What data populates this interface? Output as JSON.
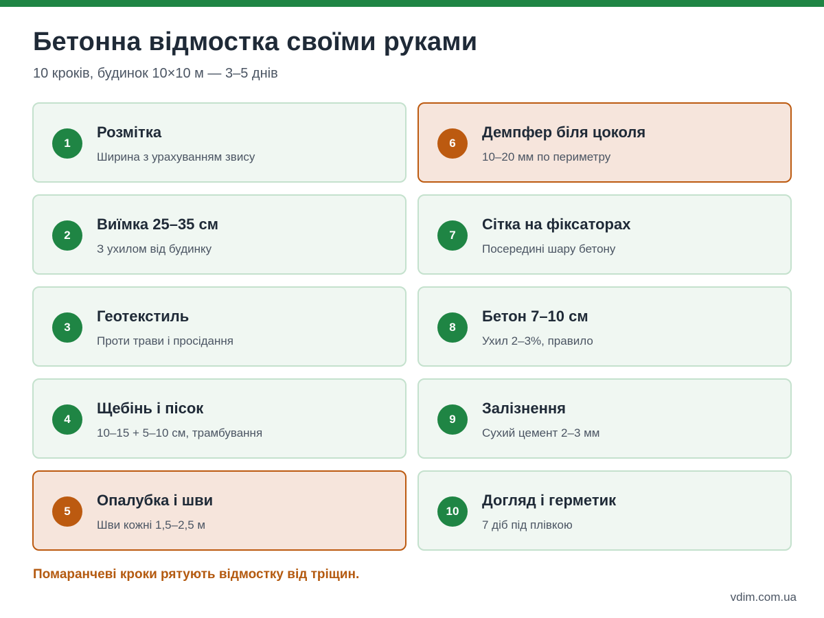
{
  "header": {
    "title": "Бетонна відмостка своїми руками",
    "subtitle": "10 кроків, будинок 10×10 м — 3–5 днів"
  },
  "colors": {
    "accent_green": "#1f8544",
    "accent_orange": "#bc5a10",
    "card_green_bg": "#f0f7f2",
    "card_orange_bg": "#f6e5dc"
  },
  "steps": [
    {
      "number": "1",
      "title": "Розмітка",
      "desc": "Ширина з урахуванням звису",
      "highlight": false
    },
    {
      "number": "2",
      "title": "Виїмка 25–35 см",
      "desc": "З ухилом від будинку",
      "highlight": false
    },
    {
      "number": "3",
      "title": "Геотекстиль",
      "desc": "Проти трави і просідання",
      "highlight": false
    },
    {
      "number": "4",
      "title": "Щебінь і пісок",
      "desc": "10–15 + 5–10 см, трамбування",
      "highlight": false
    },
    {
      "number": "5",
      "title": "Опалубка і шви",
      "desc": "Шви кожні 1,5–2,5 м",
      "highlight": true
    },
    {
      "number": "6",
      "title": "Демпфер біля цоколя",
      "desc": "10–20 мм по периметру",
      "highlight": true
    },
    {
      "number": "7",
      "title": "Сітка на фіксаторах",
      "desc": "Посередині шару бетону",
      "highlight": false
    },
    {
      "number": "8",
      "title": "Бетон 7–10 см",
      "desc": "Ухил 2–3%, правило",
      "highlight": false
    },
    {
      "number": "9",
      "title": "Залізнення",
      "desc": "Сухий цемент 2–3 мм",
      "highlight": false
    },
    {
      "number": "10",
      "title": "Догляд і герметик",
      "desc": "7 діб під плівкою",
      "highlight": false
    }
  ],
  "footer": {
    "note": "Помаранчеві кроки рятують відмостку від тріщин.",
    "site": "vdim.com.ua"
  }
}
